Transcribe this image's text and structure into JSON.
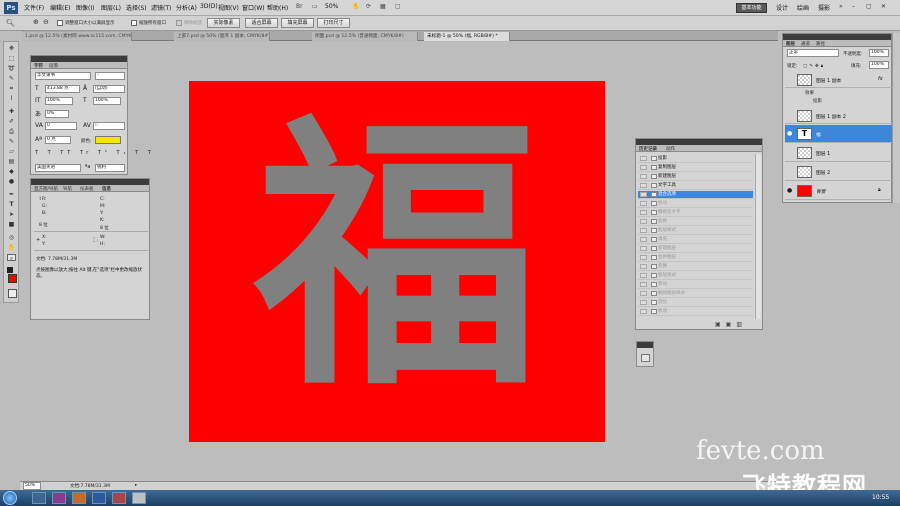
{
  "menu": {
    "logo": "Ps",
    "items": [
      "文件(F)",
      "编辑(E)",
      "图像(I)",
      "图层(L)",
      "选择(S)",
      "滤镜(T)",
      "分析(A)",
      "3D(D)",
      "视图(V)",
      "窗口(W)",
      "帮助(H)"
    ],
    "zoom": "50%",
    "workspace_button": "基本功能",
    "workspaces": [
      "设计",
      "绘画",
      "摄影"
    ]
  },
  "options_bar": {
    "check1": "调整窗口大小以满屏显示",
    "check2": "缩放所有窗口",
    "check3": "细微缩放",
    "buttons": [
      "实际像素",
      "适合屏幕",
      "填充屏幕",
      "打印尺寸"
    ]
  },
  "doc_tabs": [
    "1.psd @ 12.5% (素材网 www.sc115.com, CMYK/8#)",
    "上部7.psd @ 50% (图序 1 副本, CMYK/8#)",
    "侧面.psd @ 12.5% (普通侧面, CMYK/8#)",
    "未标题-1 @ 50% (福, RGB/8#) *"
  ],
  "canvas": {
    "character": "福",
    "bg_color": "#fe0000",
    "text_color": "#808080"
  },
  "character_panel": {
    "tabs": [
      "字符",
      "段落"
    ],
    "font_family": "华文隶书",
    "font_style": "-",
    "font_size": "413.88 点",
    "leading": "(自动)",
    "vertical_scale": "100%",
    "horizontal_scale": "100%",
    "tracking_kerning": "0%",
    "kerning": "0",
    "tracking": "0",
    "baseline": "0 点",
    "color_label": "颜色:",
    "color": "#f5e400",
    "style_buttons": [
      "T",
      "T",
      "TT",
      "Tr",
      "T¹",
      "T₁",
      "T",
      "T"
    ],
    "language": "美国英语",
    "antialias": "锐利"
  },
  "info_panel": {
    "tabs": [
      "直方图/导航",
      "导航",
      "仪表板",
      "信息"
    ],
    "rgb_labels": [
      "R:",
      "G:",
      "B:"
    ],
    "cmyk_labels": [
      "C:",
      "M:",
      "Y:",
      "K:"
    ],
    "bit1": "8 位",
    "bit2": "8 位",
    "xy_labels": [
      "X:",
      "Y:"
    ],
    "wh_labels": [
      "W:",
      "H:"
    ],
    "doc_size": "文档: 7.78M/31.3M",
    "hint": "点按图像以放大;按住 Alt 键,在\"选项\"栏中更改缩放状态。"
  },
  "history_panel": {
    "tabs": [
      "历史记录",
      "动作"
    ],
    "items": [
      {
        "label": "投影",
        "state": "normal"
      },
      {
        "label": "复制图层",
        "state": "normal"
      },
      {
        "label": "新建图层",
        "state": "normal"
      },
      {
        "label": "文字工具",
        "state": "normal"
      },
      {
        "label": "混合选项",
        "state": "selected"
      },
      {
        "label": "移动",
        "state": "dim"
      },
      {
        "label": "栅格化文字",
        "state": "dim"
      },
      {
        "label": "变换",
        "state": "dim"
      },
      {
        "label": "图层样式",
        "state": "dim"
      },
      {
        "label": "填充",
        "state": "dim"
      },
      {
        "label": "新建图层",
        "state": "dim"
      },
      {
        "label": "合并图层",
        "state": "dim"
      },
      {
        "label": "变换",
        "state": "dim"
      },
      {
        "label": "图层样式",
        "state": "dim"
      },
      {
        "label": "移动",
        "state": "dim"
      },
      {
        "label": "删除图层样式",
        "state": "dim"
      },
      {
        "label": "羽化",
        "state": "dim"
      },
      {
        "label": "移动",
        "state": "dim"
      }
    ]
  },
  "layers_panel": {
    "tabs": [
      "图层",
      "通道",
      "路径"
    ],
    "blend_mode": "正常",
    "opacity_label": "不透明度:",
    "opacity": "100%",
    "lock_label": "锁定:",
    "fill_label": "填充:",
    "fill": "100%",
    "fx": "fx",
    "effects_label": "效果",
    "effect_shadow": "投影",
    "layers": [
      {
        "name": "图层 1 副本",
        "selected": false,
        "visible": false
      },
      {
        "name": "图层 1 副本 2",
        "selected": false,
        "visible": false
      },
      {
        "name": "福",
        "selected": true,
        "visible": true
      },
      {
        "name": "图层 1",
        "selected": false,
        "visible": false
      },
      {
        "name": "图层 2",
        "selected": false,
        "visible": false
      },
      {
        "name": "背景",
        "selected": false,
        "visible": true
      }
    ]
  },
  "status_bar": {
    "zoom": "50%",
    "doc": "文档:7.78M/31.3M"
  },
  "taskbar": {
    "time": "10:55"
  },
  "watermark": {
    "en": "fevte.com",
    "cn": "飞特教程网"
  }
}
